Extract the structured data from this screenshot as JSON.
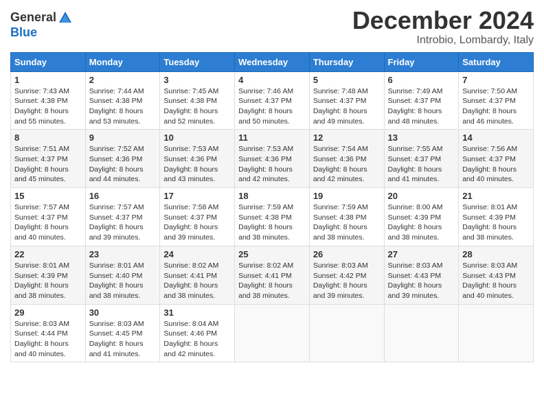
{
  "header": {
    "logo_line1": "General",
    "logo_line2": "Blue",
    "month_title": "December 2024",
    "location": "Introbio, Lombardy, Italy"
  },
  "weekdays": [
    "Sunday",
    "Monday",
    "Tuesday",
    "Wednesday",
    "Thursday",
    "Friday",
    "Saturday"
  ],
  "weeks": [
    [
      {
        "day": "1",
        "sunrise": "Sunrise: 7:43 AM",
        "sunset": "Sunset: 4:38 PM",
        "daylight": "Daylight: 8 hours and 55 minutes."
      },
      {
        "day": "2",
        "sunrise": "Sunrise: 7:44 AM",
        "sunset": "Sunset: 4:38 PM",
        "daylight": "Daylight: 8 hours and 53 minutes."
      },
      {
        "day": "3",
        "sunrise": "Sunrise: 7:45 AM",
        "sunset": "Sunset: 4:38 PM",
        "daylight": "Daylight: 8 hours and 52 minutes."
      },
      {
        "day": "4",
        "sunrise": "Sunrise: 7:46 AM",
        "sunset": "Sunset: 4:37 PM",
        "daylight": "Daylight: 8 hours and 50 minutes."
      },
      {
        "day": "5",
        "sunrise": "Sunrise: 7:48 AM",
        "sunset": "Sunset: 4:37 PM",
        "daylight": "Daylight: 8 hours and 49 minutes."
      },
      {
        "day": "6",
        "sunrise": "Sunrise: 7:49 AM",
        "sunset": "Sunset: 4:37 PM",
        "daylight": "Daylight: 8 hours and 48 minutes."
      },
      {
        "day": "7",
        "sunrise": "Sunrise: 7:50 AM",
        "sunset": "Sunset: 4:37 PM",
        "daylight": "Daylight: 8 hours and 46 minutes."
      }
    ],
    [
      {
        "day": "8",
        "sunrise": "Sunrise: 7:51 AM",
        "sunset": "Sunset: 4:37 PM",
        "daylight": "Daylight: 8 hours and 45 minutes."
      },
      {
        "day": "9",
        "sunrise": "Sunrise: 7:52 AM",
        "sunset": "Sunset: 4:36 PM",
        "daylight": "Daylight: 8 hours and 44 minutes."
      },
      {
        "day": "10",
        "sunrise": "Sunrise: 7:53 AM",
        "sunset": "Sunset: 4:36 PM",
        "daylight": "Daylight: 8 hours and 43 minutes."
      },
      {
        "day": "11",
        "sunrise": "Sunrise: 7:53 AM",
        "sunset": "Sunset: 4:36 PM",
        "daylight": "Daylight: 8 hours and 42 minutes."
      },
      {
        "day": "12",
        "sunrise": "Sunrise: 7:54 AM",
        "sunset": "Sunset: 4:36 PM",
        "daylight": "Daylight: 8 hours and 42 minutes."
      },
      {
        "day": "13",
        "sunrise": "Sunrise: 7:55 AM",
        "sunset": "Sunset: 4:37 PM",
        "daylight": "Daylight: 8 hours and 41 minutes."
      },
      {
        "day": "14",
        "sunrise": "Sunrise: 7:56 AM",
        "sunset": "Sunset: 4:37 PM",
        "daylight": "Daylight: 8 hours and 40 minutes."
      }
    ],
    [
      {
        "day": "15",
        "sunrise": "Sunrise: 7:57 AM",
        "sunset": "Sunset: 4:37 PM",
        "daylight": "Daylight: 8 hours and 40 minutes."
      },
      {
        "day": "16",
        "sunrise": "Sunrise: 7:57 AM",
        "sunset": "Sunset: 4:37 PM",
        "daylight": "Daylight: 8 hours and 39 minutes."
      },
      {
        "day": "17",
        "sunrise": "Sunrise: 7:58 AM",
        "sunset": "Sunset: 4:37 PM",
        "daylight": "Daylight: 8 hours and 39 minutes."
      },
      {
        "day": "18",
        "sunrise": "Sunrise: 7:59 AM",
        "sunset": "Sunset: 4:38 PM",
        "daylight": "Daylight: 8 hours and 38 minutes."
      },
      {
        "day": "19",
        "sunrise": "Sunrise: 7:59 AM",
        "sunset": "Sunset: 4:38 PM",
        "daylight": "Daylight: 8 hours and 38 minutes."
      },
      {
        "day": "20",
        "sunrise": "Sunrise: 8:00 AM",
        "sunset": "Sunset: 4:39 PM",
        "daylight": "Daylight: 8 hours and 38 minutes."
      },
      {
        "day": "21",
        "sunrise": "Sunrise: 8:01 AM",
        "sunset": "Sunset: 4:39 PM",
        "daylight": "Daylight: 8 hours and 38 minutes."
      }
    ],
    [
      {
        "day": "22",
        "sunrise": "Sunrise: 8:01 AM",
        "sunset": "Sunset: 4:39 PM",
        "daylight": "Daylight: 8 hours and 38 minutes."
      },
      {
        "day": "23",
        "sunrise": "Sunrise: 8:01 AM",
        "sunset": "Sunset: 4:40 PM",
        "daylight": "Daylight: 8 hours and 38 minutes."
      },
      {
        "day": "24",
        "sunrise": "Sunrise: 8:02 AM",
        "sunset": "Sunset: 4:41 PM",
        "daylight": "Daylight: 8 hours and 38 minutes."
      },
      {
        "day": "25",
        "sunrise": "Sunrise: 8:02 AM",
        "sunset": "Sunset: 4:41 PM",
        "daylight": "Daylight: 8 hours and 38 minutes."
      },
      {
        "day": "26",
        "sunrise": "Sunrise: 8:03 AM",
        "sunset": "Sunset: 4:42 PM",
        "daylight": "Daylight: 8 hours and 39 minutes."
      },
      {
        "day": "27",
        "sunrise": "Sunrise: 8:03 AM",
        "sunset": "Sunset: 4:43 PM",
        "daylight": "Daylight: 8 hours and 39 minutes."
      },
      {
        "day": "28",
        "sunrise": "Sunrise: 8:03 AM",
        "sunset": "Sunset: 4:43 PM",
        "daylight": "Daylight: 8 hours and 40 minutes."
      }
    ],
    [
      {
        "day": "29",
        "sunrise": "Sunrise: 8:03 AM",
        "sunset": "Sunset: 4:44 PM",
        "daylight": "Daylight: 8 hours and 40 minutes."
      },
      {
        "day": "30",
        "sunrise": "Sunrise: 8:03 AM",
        "sunset": "Sunset: 4:45 PM",
        "daylight": "Daylight: 8 hours and 41 minutes."
      },
      {
        "day": "31",
        "sunrise": "Sunrise: 8:04 AM",
        "sunset": "Sunset: 4:46 PM",
        "daylight": "Daylight: 8 hours and 42 minutes."
      },
      null,
      null,
      null,
      null
    ]
  ]
}
